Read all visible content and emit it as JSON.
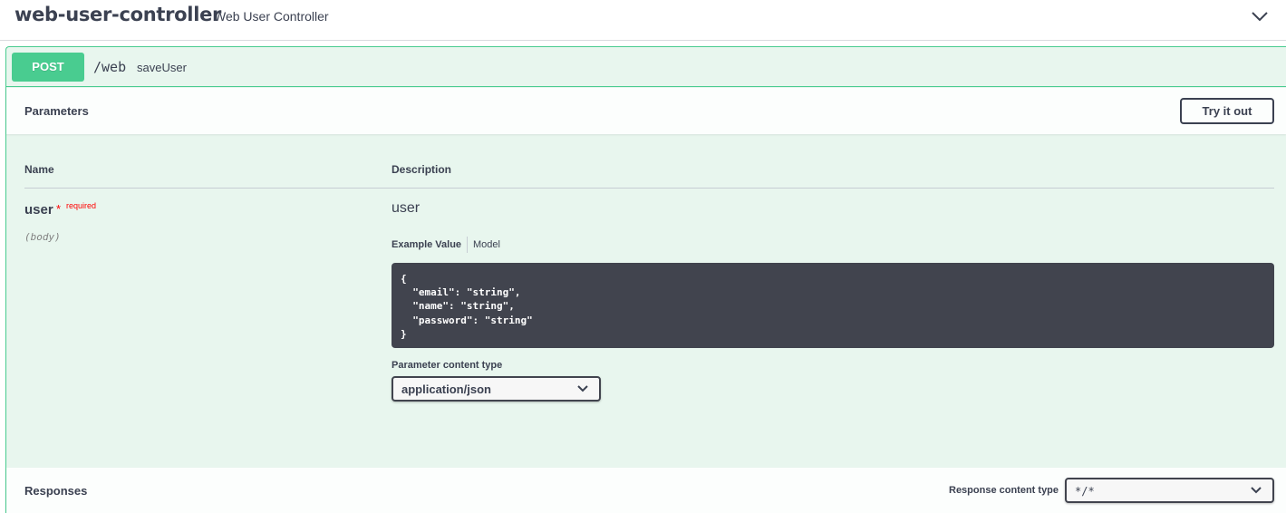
{
  "tag": {
    "title": "web-user-controller",
    "description": "Web User Controller"
  },
  "operation": {
    "method": "POST",
    "path": "/web",
    "summary": "saveUser",
    "accent_color": "#49cc90"
  },
  "parameters": {
    "section_title": "Parameters",
    "try_button_label": "Try it out",
    "columns": {
      "name": "Name",
      "description": "Description"
    },
    "items": [
      {
        "name": "user",
        "required_star": "*",
        "required_label": "required",
        "location": "(body)",
        "description": "user",
        "tabs": {
          "example": "Example Value",
          "model": "Model"
        },
        "example_lines": [
          "{",
          "  \"email\": \"string\",",
          "  \"name\": \"string\",",
          "  \"password\": \"string\"",
          "}"
        ],
        "content_type_label": "Parameter content type",
        "content_type_value": "application/json"
      }
    ]
  },
  "responses": {
    "section_title": "Responses",
    "content_type_label": "Response content type",
    "content_type_value": "*/*"
  }
}
